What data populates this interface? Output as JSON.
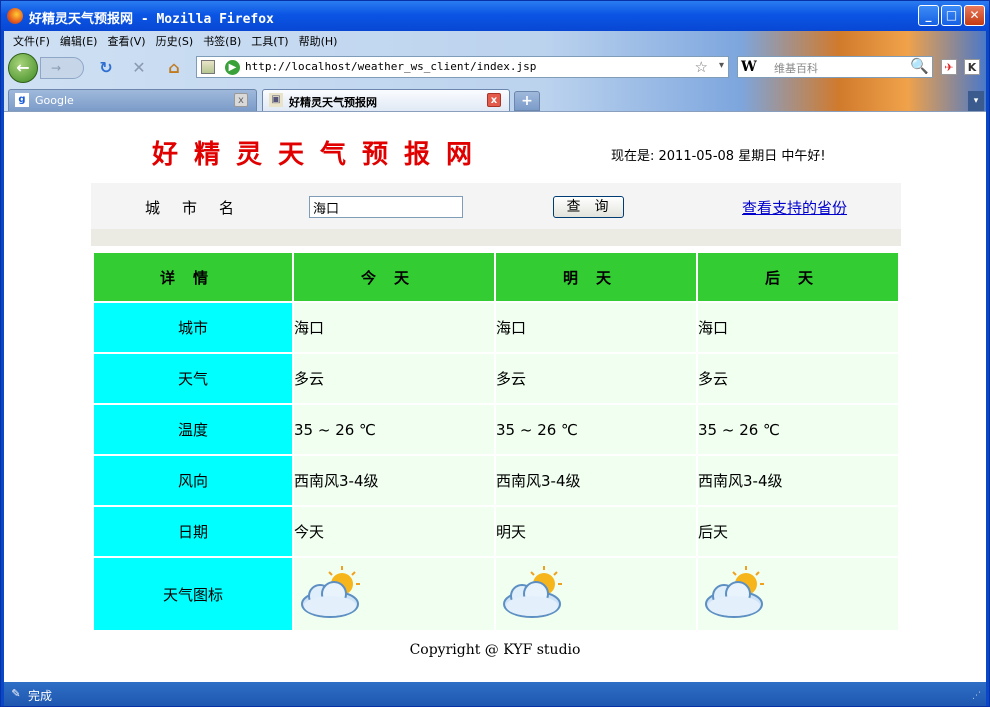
{
  "window": {
    "title": "好精灵天气预报网 - Mozilla Firefox",
    "minimize": "_",
    "maximize": "□",
    "close": "✕"
  },
  "menu": [
    "文件(F)",
    "编辑(E)",
    "查看(V)",
    "历史(S)",
    "书签(B)",
    "工具(T)",
    "帮助(H)"
  ],
  "nav": {
    "back": "←",
    "forward": "→",
    "reload": "↻",
    "stop": "✕",
    "home": "⌂",
    "url": "http://localhost/weather_ws_client/index.jsp",
    "star": "☆",
    "url_dropdown": "▾"
  },
  "search": {
    "engine_icon": "W",
    "placeholder": "维基百科",
    "search_icon": "🔍"
  },
  "tabs": [
    {
      "label": "Google",
      "favicon": "g"
    },
    {
      "label": "好精灵天气预报网",
      "favicon": "▣"
    }
  ],
  "tab_close": "x",
  "new_tab": "+",
  "tab_list": "▾",
  "page": {
    "site_title": "好精灵天气预报网",
    "date_line": "现在是: 2011-05-08 星期日 中午好!",
    "city_label": "城市名",
    "city_value": "海口",
    "query_button": "查询",
    "province_link": "查看支持的省份",
    "table": {
      "headers": [
        "详情",
        "今天",
        "明天",
        "后天"
      ],
      "rows": [
        {
          "label": "城市",
          "cells": [
            "海口",
            "海口",
            "海口"
          ]
        },
        {
          "label": "天气",
          "cells": [
            "多云",
            "多云",
            "多云"
          ]
        },
        {
          "label": "温度",
          "cells": [
            "35 ~ 26 ℃",
            "35 ~ 26 ℃",
            "35 ~ 26 ℃"
          ]
        },
        {
          "label": "风向",
          "cells": [
            "西南风3-4级",
            "西南风3-4级",
            "西南风3-4级"
          ]
        },
        {
          "label": "日期",
          "cells": [
            "今天",
            "明天",
            "后天"
          ]
        }
      ],
      "icon_row_label": "天气图标",
      "icon_name": "partly-cloudy-icon"
    },
    "copyright": "Copyright @ KYF studio"
  },
  "status": {
    "text": "完成"
  },
  "colors": {
    "title_red": "#e00000",
    "header_green": "#33cc33",
    "rowhead_cyan": "#00ffff",
    "cell_bg": "#f0fff0",
    "link_blue": "#0000cc"
  }
}
